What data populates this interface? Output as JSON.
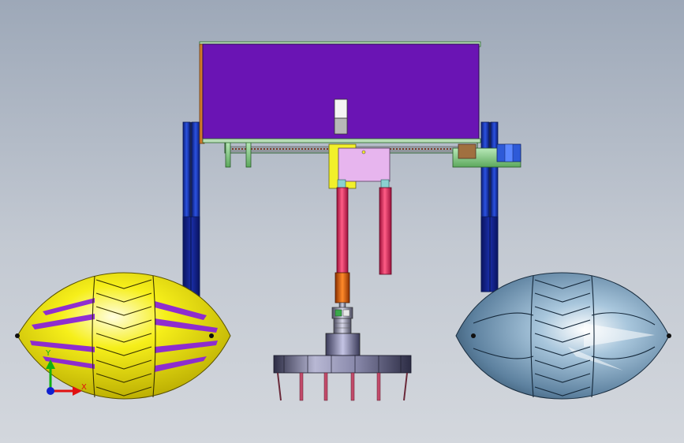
{
  "colors": {
    "background_top": "#9da8b8",
    "background_bottom": "#d3d7dd",
    "control_box": "#6a14b4",
    "carriage": "#e7b5ee",
    "frame_post": "#1836b0",
    "cylinder": "#e0285a",
    "left_wheel": "#f4ee12",
    "left_wheel_stripe": "#8a24d8",
    "right_wheel": "#8aaec8",
    "axis_x": "#e01010",
    "axis_y": "#10b010",
    "axis_z": "#1020d0"
  },
  "icons": {
    "triad": "coordinate-triad-icon"
  },
  "triad": {
    "x_label": "X",
    "y_label": "Y"
  }
}
